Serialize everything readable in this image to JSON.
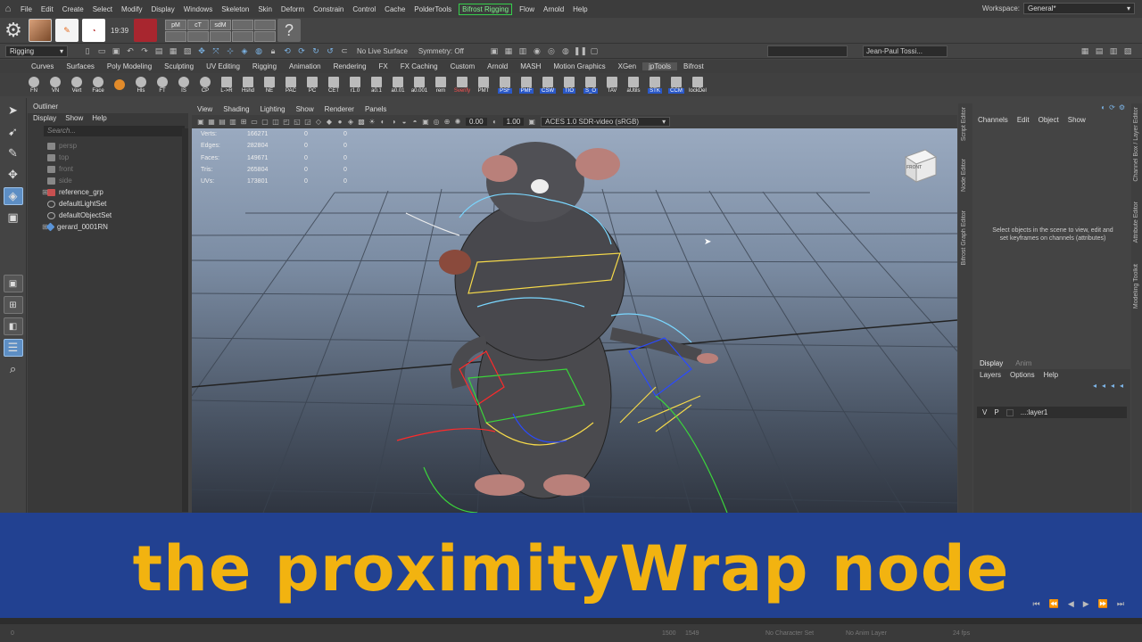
{
  "menubar": {
    "items": [
      "File",
      "Edit",
      "Create",
      "Select",
      "Modify",
      "Display",
      "Windows",
      "Skeleton",
      "Skin",
      "Deform",
      "Constrain",
      "Control",
      "Cache",
      "PolderTools",
      "Bifrost Rigging",
      "Flow",
      "Arnold",
      "Help"
    ],
    "highlighted": "Bifrost Rigging",
    "workspace_label": "Workspace:",
    "workspace_value": "General*"
  },
  "shelf_top": {
    "time": "19:39",
    "tiles": [
      "pM",
      "cT",
      "sdM",
      "",
      "",
      "",
      "",
      "",
      "",
      ""
    ]
  },
  "statusline": {
    "mode": "Rigging",
    "live_surface": "No Live Surface",
    "symmetry": "Symmetry: Off",
    "user": "Jean-Paul Tossi..."
  },
  "shelf_tabs": [
    "Curves",
    "Surfaces",
    "Poly Modeling",
    "Sculpting",
    "UV Editing",
    "Rigging",
    "Animation",
    "Rendering",
    "FX",
    "FX Caching",
    "Custom",
    "Arnold",
    "MASH",
    "Motion Graphics",
    "XGen",
    "jpTools",
    "Bifrost"
  ],
  "active_shelf_tab": "jpTools",
  "shelf_buttons": [
    "FN",
    "VN",
    "Vert",
    "Face",
    "",
    "Hls",
    "FT",
    "IS",
    "CP",
    "L->R",
    "Hshd",
    "NE",
    "PAC",
    "PC",
    "CET",
    "r1.0",
    "a0.1",
    "a0.01",
    "a0.001",
    "rem",
    "Sverify",
    "PMT",
    "PSF",
    "PMF",
    "CSW",
    "TIO",
    "S_O",
    "TAV",
    "aUtils",
    "STK",
    "CCM",
    "lockDel"
  ],
  "outliner": {
    "title": "Outliner",
    "menu": [
      "Display",
      "Show",
      "Help"
    ],
    "search_placeholder": "Search...",
    "rows": [
      {
        "label": "persp",
        "kind": "cam",
        "dim": true
      },
      {
        "label": "top",
        "kind": "cam",
        "dim": true
      },
      {
        "label": "front",
        "kind": "cam",
        "dim": true
      },
      {
        "label": "side",
        "kind": "cam",
        "dim": true
      },
      {
        "label": "reference_grp",
        "kind": "ref",
        "dim": false
      },
      {
        "label": "defaultLightSet",
        "kind": "set",
        "dim": false
      },
      {
        "label": "defaultObjectSet",
        "kind": "set",
        "dim": false
      },
      {
        "label": "gerard_0001RN",
        "kind": "rn",
        "dim": false
      }
    ]
  },
  "viewport": {
    "menu": [
      "View",
      "Shading",
      "Lighting",
      "Show",
      "Renderer",
      "Panels"
    ],
    "exposure": "0.00",
    "gamma": "1.00",
    "color_space": "ACES 1.0 SDR-video (sRGB)",
    "viewcube_label": "FRONT",
    "hud": [
      {
        "label": "Verts:",
        "value": "166271",
        "a": "0",
        "b": "0"
      },
      {
        "label": "Edges:",
        "value": "282804",
        "a": "0",
        "b": "0"
      },
      {
        "label": "Faces:",
        "value": "149671",
        "a": "0",
        "b": "0"
      },
      {
        "label": "Tris:",
        "value": "265804",
        "a": "0",
        "b": "0"
      },
      {
        "label": "UVs:",
        "value": "173801",
        "a": "0",
        "b": "0"
      }
    ]
  },
  "side_tabs": [
    "Script Editor",
    "Node Editor",
    "Bifrost Graph Editor"
  ],
  "right_tabs": [
    "Channel Box / Layer Editor",
    "Attribute Editor",
    "Modeling Toolkit"
  ],
  "channelbox": {
    "menu": [
      "Channels",
      "Edit",
      "Object",
      "Show"
    ],
    "message": "Select objects in the scene to view, edit and set keyframes on channels (attributes)"
  },
  "layers": {
    "tabs": [
      "Display",
      "Anim"
    ],
    "menu": [
      "Layers",
      "Options",
      "Help"
    ],
    "row": {
      "v": "V",
      "p": "P",
      "name": "...:layer1"
    }
  },
  "caption": "the proximityWrap node",
  "bottom": {
    "start": "0",
    "range_start": "1500",
    "range_end": "1549",
    "character_set": "No Character Set",
    "anim_layer": "No Anim Layer",
    "fps": "24 fps"
  },
  "colors": {
    "accent": "#36d04c",
    "caption_text": "#f2b310",
    "caption_band": "#214299"
  }
}
